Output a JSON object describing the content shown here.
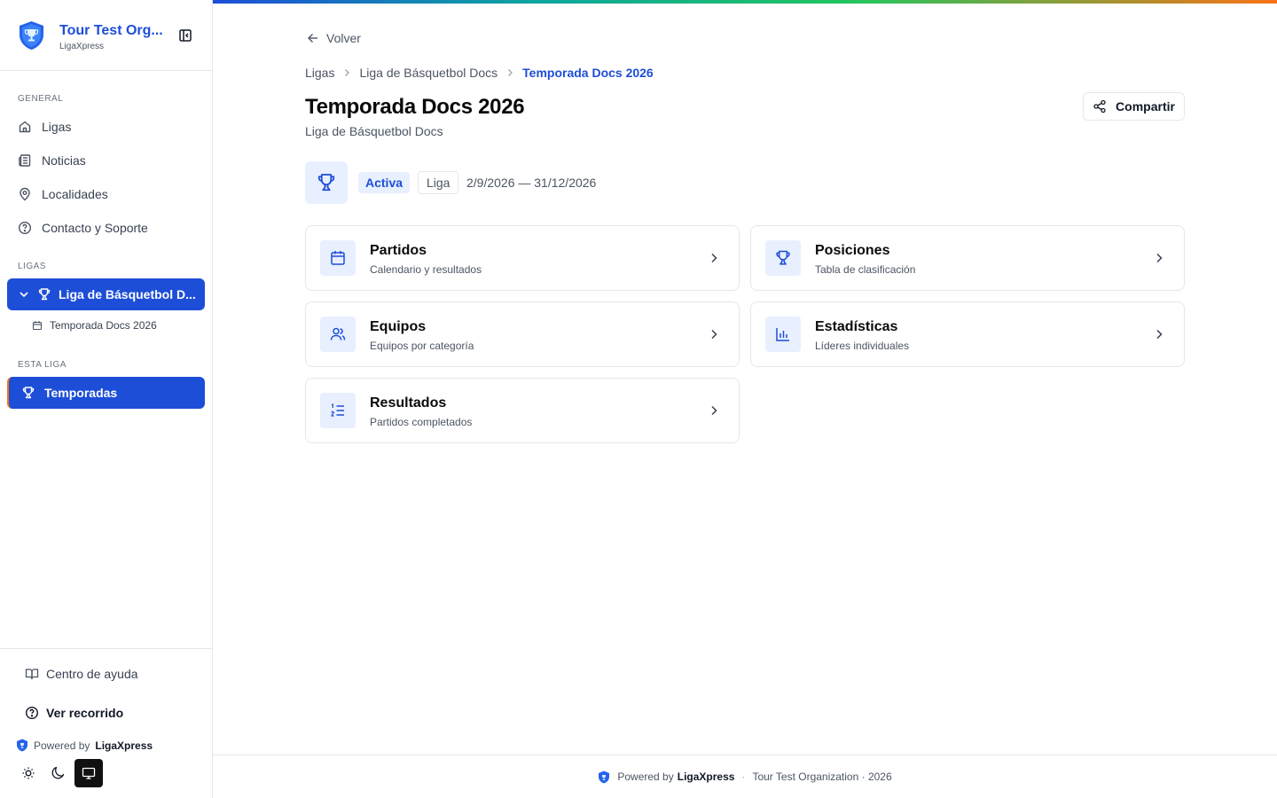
{
  "sidebar": {
    "brand_title": "Tour Test Org...",
    "brand_subtitle": "LigaXpress",
    "sections": {
      "general": "GENERAL",
      "ligas": "LIGAS",
      "esta_liga": "ESTA LIGA"
    },
    "general_items": [
      {
        "label": "Ligas",
        "icon": "home-icon"
      },
      {
        "label": "Noticias",
        "icon": "newspaper-icon"
      },
      {
        "label": "Localidades",
        "icon": "map-pin-icon"
      },
      {
        "label": "Contacto y Soporte",
        "icon": "help-circle-icon"
      }
    ],
    "league_item": "Liga de Básquetbol D...",
    "season_item": "Temporada Docs 2026",
    "league_nav": "Temporadas",
    "help_center": "Centro de ayuda",
    "view_tour": "Ver recorrido",
    "powered_prefix": "Powered by",
    "powered_brand": "LigaXpress"
  },
  "header": {
    "back_label": "Volver",
    "breadcrumb": [
      "Ligas",
      "Liga de Básquetbol Docs",
      "Temporada Docs 2026"
    ],
    "title": "Temporada Docs 2026",
    "subtitle": "Liga de Básquetbol Docs",
    "share_label": "Compartir"
  },
  "season": {
    "status": "Activa",
    "type": "Liga",
    "dates": "2/9/2026 — 31/12/2026"
  },
  "cards": [
    {
      "title": "Partidos",
      "desc": "Calendario y resultados",
      "icon": "calendar-icon"
    },
    {
      "title": "Posiciones",
      "desc": "Tabla de clasificación",
      "icon": "trophy-icon"
    },
    {
      "title": "Equipos",
      "desc": "Equipos por categoría",
      "icon": "users-icon"
    },
    {
      "title": "Estadísticas",
      "desc": "Líderes individuales",
      "icon": "bar-chart-icon"
    },
    {
      "title": "Resultados",
      "desc": "Partidos completados",
      "icon": "list-ordered-icon"
    }
  ],
  "footer": {
    "powered_prefix": "Powered by",
    "powered_brand": "LigaXpress",
    "separator": "·",
    "org": "Tour Test Organization · 2026"
  },
  "colors": {
    "accent": "#1d4ed8",
    "accent_light": "#e8efff",
    "border": "#e5e7eb"
  }
}
